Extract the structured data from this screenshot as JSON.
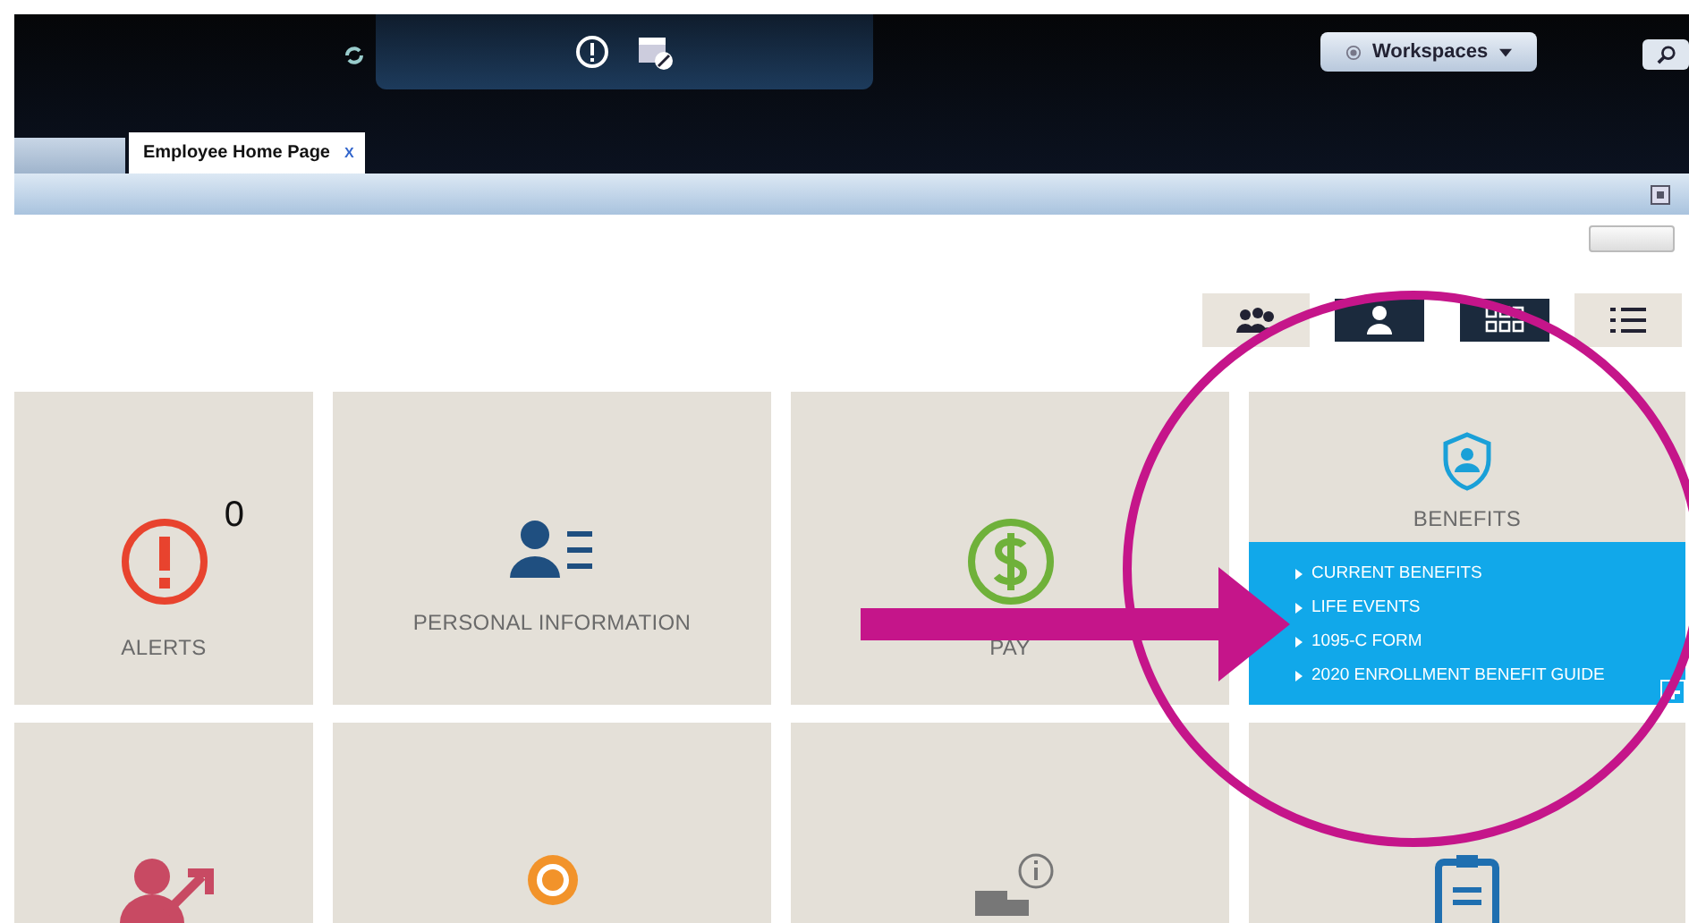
{
  "header": {
    "workspaces": "Workspaces"
  },
  "tabs": [
    {
      "selected": false
    },
    {
      "label": "Employee Home Page",
      "selected": true,
      "close": "X"
    }
  ],
  "view_toggles": [
    {
      "kind": "team",
      "selected": false
    },
    {
      "kind": "person",
      "selected": true
    },
    {
      "kind": "grid",
      "selected": true
    },
    {
      "kind": "list",
      "selected": false
    }
  ],
  "tiles": [
    {
      "kind": "alert",
      "label": "ALERTS",
      "badge": "0"
    },
    {
      "kind": "person",
      "label": "PERSONAL INFORMATION"
    },
    {
      "kind": "pay",
      "label": "PAY"
    },
    {
      "kind": "shield",
      "label": "BENEFITS",
      "links": [
        "CURRENT BENEFITS",
        "LIFE EVENTS",
        "1095-C FORM",
        "2020 ENROLLMENT BENEFIT GUIDE"
      ]
    },
    {
      "kind": "growth"
    },
    {
      "kind": "award"
    },
    {
      "kind": "building"
    },
    {
      "kind": "clipboard"
    }
  ]
}
